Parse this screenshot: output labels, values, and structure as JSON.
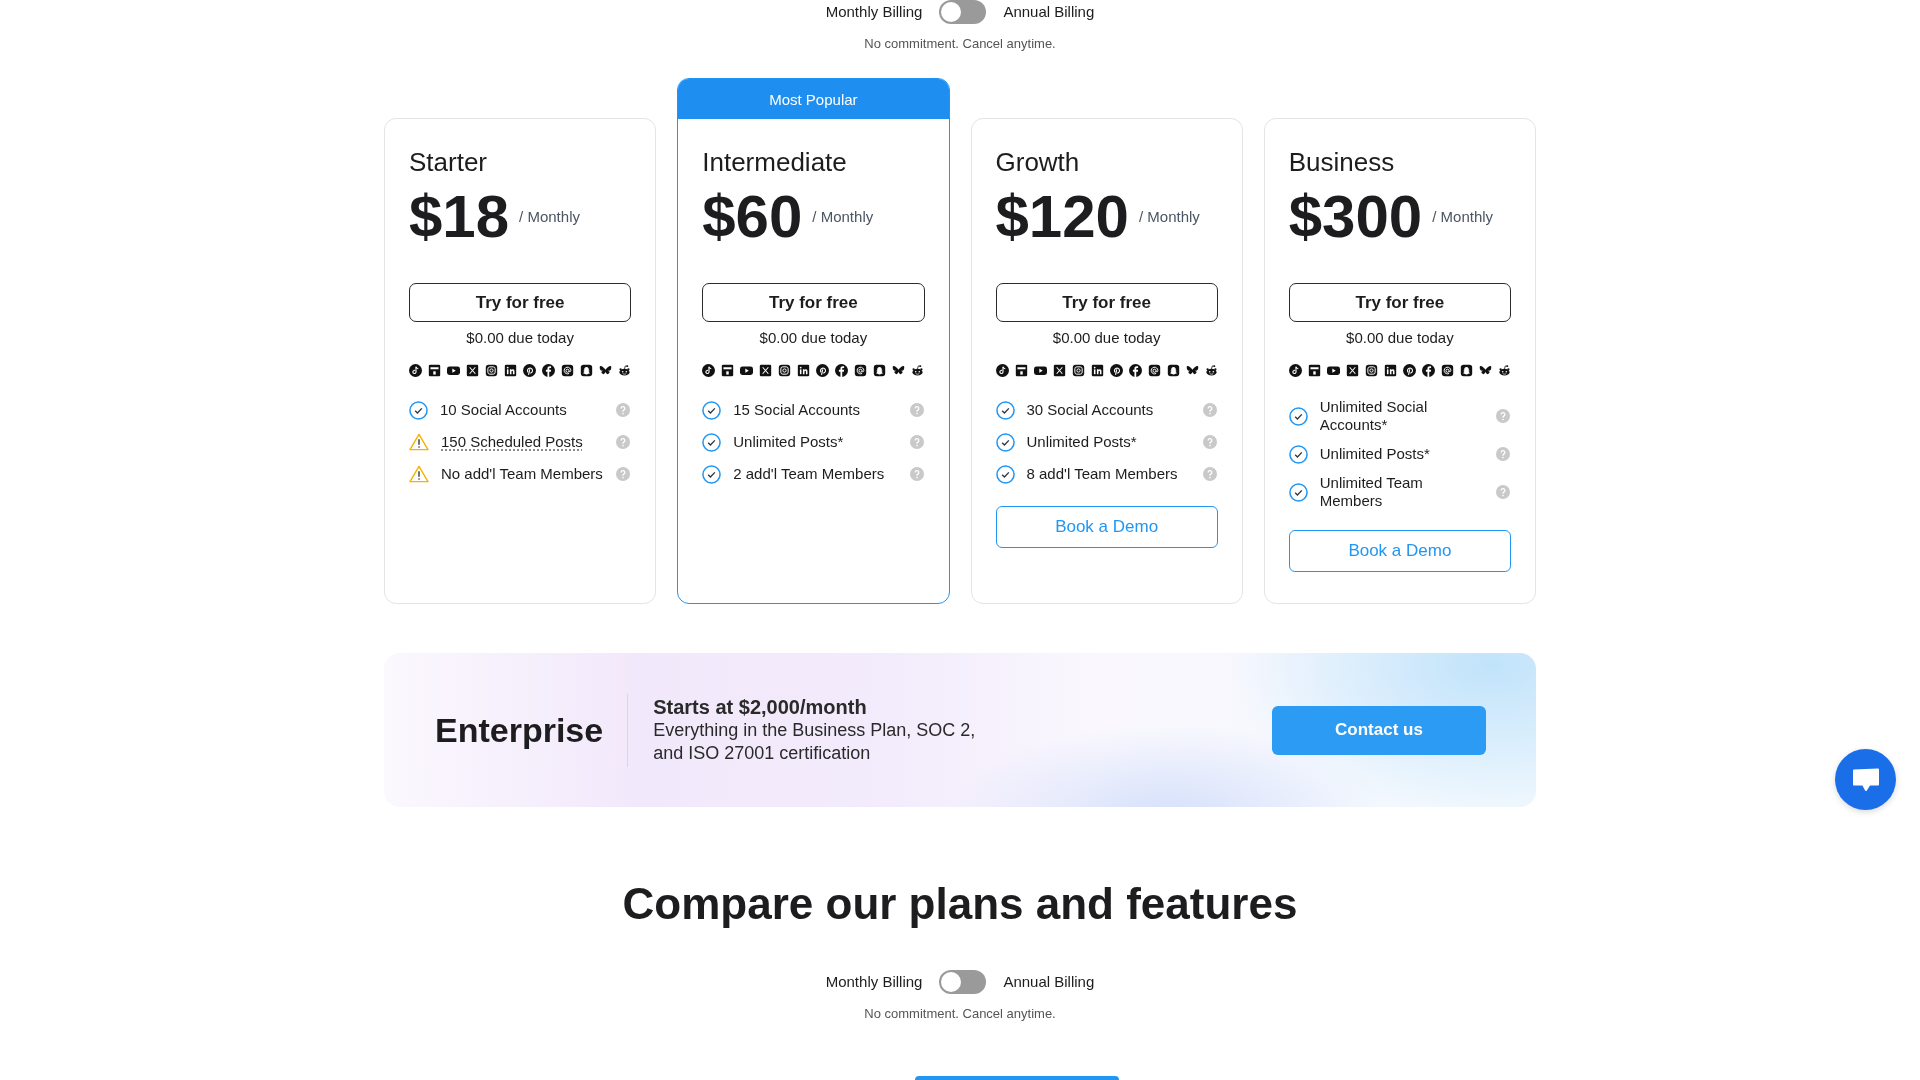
{
  "billing_top": {
    "monthly_label": "Monthly Billing",
    "toggle": {
      "on": false
    },
    "annual_label": "Annual Billing",
    "note": "No commitment. Cancel anytime."
  },
  "plans": [
    {
      "name": "Starter",
      "highlighted": false,
      "price": "$18",
      "period": "/ Monthly",
      "cta": "Try for free",
      "due": "$0.00 due today",
      "features": [
        {
          "kind": "check",
          "text": "10 Social Accounts",
          "underlined": false
        },
        {
          "kind": "warning",
          "text": "150 Scheduled Posts",
          "underlined": true
        },
        {
          "kind": "warning",
          "text": "No add'l Team Members",
          "underlined": false
        }
      ]
    },
    {
      "badge": "Most Popular",
      "name": "Intermediate",
      "highlighted": true,
      "price": "$60",
      "period": "/ Monthly",
      "cta": "Try for free",
      "due": "$0.00 due today",
      "features": [
        {
          "kind": "check",
          "text": "15 Social Accounts",
          "underlined": false
        },
        {
          "kind": "check",
          "text": "Unlimited Posts*",
          "underlined": false
        },
        {
          "kind": "check",
          "text": "2 add'l Team Members",
          "underlined": false
        }
      ]
    },
    {
      "name": "Growth",
      "highlighted": false,
      "price": "$120",
      "period": "/ Monthly",
      "cta": "Try for free",
      "due": "$0.00 due today",
      "features": [
        {
          "kind": "check",
          "text": "30 Social Accounts",
          "underlined": false
        },
        {
          "kind": "check",
          "text": "Unlimited Posts*",
          "underlined": false
        },
        {
          "kind": "check",
          "text": "8 add'l Team Members",
          "underlined": false
        }
      ],
      "demo_button": "Book a Demo"
    },
    {
      "name": "Business",
      "highlighted": false,
      "price": "$300",
      "period": "/ Monthly",
      "cta": "Try for free",
      "due": "$0.00 due today",
      "features": [
        {
          "kind": "check",
          "text": "Unlimited Social Accounts*",
          "underlined": false
        },
        {
          "kind": "check",
          "text": "Unlimited Posts*",
          "underlined": false
        },
        {
          "kind": "check",
          "text": "Unlimited Team Members",
          "underlined": false
        }
      ],
      "demo_button": "Book a Demo"
    }
  ],
  "enterprise": {
    "title": "Enterprise",
    "headline": "Starts at $2,000/month",
    "description": "Everything in the Business Plan, SOC 2, and ISO 27001 certification",
    "button": "Contact us"
  },
  "compare": {
    "heading": "Compare our plans and features",
    "billing": {
      "monthly_label": "Monthly Billing",
      "toggle": {
        "on": false
      },
      "annual_label": "Annual Billing",
      "note": "No commitment. Cancel anytime."
    }
  }
}
